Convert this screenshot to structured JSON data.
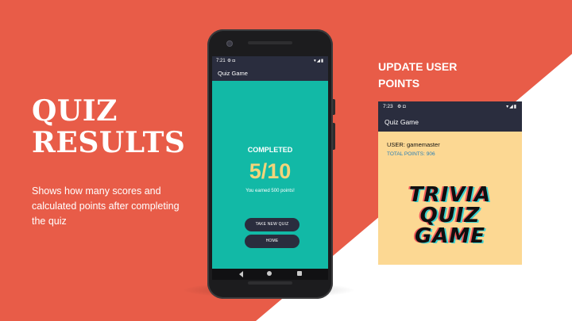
{
  "slide": {
    "title_lines": [
      "QUIZ",
      "RESULTS"
    ],
    "description": "Shows how many scores and calculated points after completing the quiz",
    "side_heading": "UPDATE USER POINTS"
  },
  "phone": {
    "status_time": "7:21",
    "status_icons_left": "⚙ ◘",
    "status_icons_right": "▾◢▮",
    "app_title": "Quiz Game",
    "completed_label": "COMPLETED",
    "score": "5/10",
    "earned_text": "You earned 500 points!",
    "buttons": {
      "take_new_quiz": "TAKE NEW QUIZ",
      "home": "HOME"
    },
    "nav_icons": [
      "back-icon",
      "home-icon",
      "recents-icon"
    ]
  },
  "user_screen": {
    "status_time": "7:23",
    "status_icons_left": "⚙ ◘",
    "status_icons_right": "▾◢▮",
    "app_title": "Quiz Game",
    "user_text": "USER: gamemaster",
    "points_text": "TOTAL POINTS: 906",
    "logo_lines": [
      "TRIVIA",
      "QUIZ",
      "GAME"
    ]
  },
  "colors": {
    "background_coral": "#e85c48",
    "app_bar": "#2a2d3e",
    "quiz_teal": "#12b9a6",
    "score_gold": "#f2d47a",
    "user_screen_bg": "#fcd893",
    "points_blue": "#2a7fb5"
  }
}
